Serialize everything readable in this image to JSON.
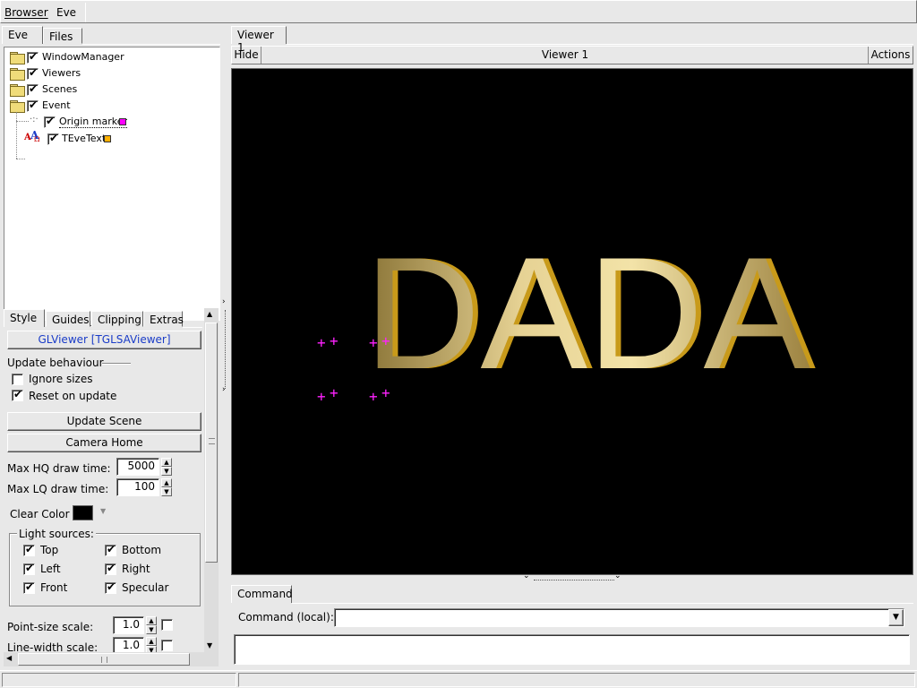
{
  "menubar": {
    "items": [
      "Browser",
      "Eve"
    ]
  },
  "left_tabs": [
    "Eve",
    "Files"
  ],
  "tree": [
    {
      "label": "WindowManager",
      "icon": "folder-icon",
      "checked": true
    },
    {
      "label": "Viewers",
      "icon": "folder-icon",
      "checked": true
    },
    {
      "label": "Scenes",
      "icon": "folder-icon",
      "checked": true
    },
    {
      "label": "Event",
      "icon": "open-folder-icon",
      "checked": true
    },
    {
      "label": "Origin marker",
      "icon": "point-set-icon",
      "checked": true,
      "color": "#ff00ff"
    },
    {
      "label": "TEveText",
      "icon": "text-icon",
      "checked": true,
      "color": "#ffb000"
    }
  ],
  "editor_tabs": [
    "Style",
    "Guides",
    "Clipping",
    "Extras"
  ],
  "editor": {
    "title_button": "GLViewer [TGLSAViewer]",
    "update_behaviour": "Update behaviour",
    "ignore_sizes": {
      "label": "Ignore sizes",
      "checked": false
    },
    "reset_on_update": {
      "label": "Reset on update",
      "checked": true
    },
    "update_scene": "Update Scene",
    "camera_home": "Camera Home",
    "max_hq": {
      "label": "Max HQ draw time:",
      "value": "5000"
    },
    "max_lq": {
      "label": "Max LQ draw time:",
      "value": "100"
    },
    "clear_color": {
      "label": "Clear Color",
      "color": "#000000"
    },
    "light_sources": {
      "title": "Light sources:",
      "items": [
        {
          "label": "Top",
          "checked": true
        },
        {
          "label": "Bottom",
          "checked": true
        },
        {
          "label": "Left",
          "checked": true
        },
        {
          "label": "Right",
          "checked": true
        },
        {
          "label": "Front",
          "checked": true
        },
        {
          "label": "Specular",
          "checked": true
        }
      ]
    },
    "point_size": {
      "label": "Point-size scale:",
      "value": "1.0"
    },
    "line_width": {
      "label": "Line-width scale:",
      "value": "1.0"
    }
  },
  "viewer": {
    "tab": "Viewer 1",
    "hide": "Hide",
    "title": "Viewer 1",
    "actions": "Actions",
    "scene_text": "DADA",
    "background": "#000000",
    "text_color": "#e6cf8a",
    "marker_color": "#ff22ff"
  },
  "command": {
    "tab": "Command",
    "label": "Command (local):",
    "value": ""
  }
}
